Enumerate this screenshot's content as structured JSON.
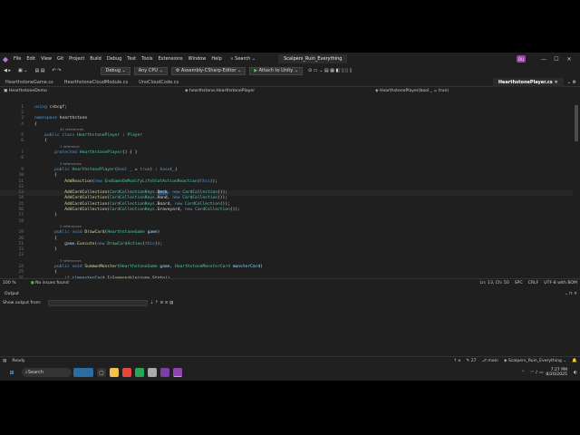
{
  "menubar": {
    "items": [
      "File",
      "Edit",
      "View",
      "Git",
      "Project",
      "Build",
      "Debug",
      "Test",
      "Tools",
      "Extensions",
      "Window",
      "Help"
    ],
    "search_label": "Search",
    "solution_name": "Scalpers_Ruin_Everything",
    "avatar_text": "DU"
  },
  "toolbar": {
    "config": "Debug",
    "platform": "Any CPU",
    "startup_project": "Assembly-CSharp-Editor",
    "attach_label": "Attach to Unity"
  },
  "tabs": [
    "HearthstoneGame.cs",
    "HearthstoneCloudModule.cs",
    "UnoCloudCode.cs",
    "HearthstonePlayer.cs"
  ],
  "navbar": {
    "project": "HearthstoneDemo",
    "type": "hearthstone.HearthstonePlayer",
    "member": "HearthstonePlayer(bool _ = true)"
  },
  "code": {
    "lines": [
      {
        "n": "1",
        "text": "using csbcgf;"
      },
      {
        "n": "2",
        "text": ""
      },
      {
        "n": "3",
        "text": "namespace hearthstone"
      },
      {
        "n": "4",
        "text": "{"
      },
      {
        "lens": "40 references"
      },
      {
        "n": "5",
        "text": "    public class HearthstonePlayer : Player"
      },
      {
        "n": "6",
        "text": "    {"
      },
      {
        "lens": "1 reference"
      },
      {
        "n": "7",
        "text": "        protected HearthstonePlayer() { }"
      },
      {
        "n": "8",
        "text": ""
      },
      {
        "lens": "3 references"
      },
      {
        "n": "9",
        "text": "        public HearthstonePlayer(bool _ = true) : base(_)"
      },
      {
        "n": "10",
        "text": "        {"
      },
      {
        "n": "11",
        "text": "            AddReaction(new EndGameOnModifyLifeStatActionReaction(this));"
      },
      {
        "n": "12",
        "text": ""
      },
      {
        "n": "13",
        "text": "            AddCardCollection(CardCollectionKeys.Deck, new CardCollection());"
      },
      {
        "n": "14",
        "text": "            AddCardCollection(CardCollectionKeys.Hand, new CardCollection());"
      },
      {
        "n": "15",
        "text": "            AddCardCollection(CardCollectionKeys.Board, new CardCollection());"
      },
      {
        "n": "16",
        "text": "            AddCardCollection(CardCollectionKeys.Graveyard, new CardCollection());"
      },
      {
        "n": "17",
        "text": "        }"
      },
      {
        "n": "18",
        "text": ""
      },
      {
        "lens": "2 references"
      },
      {
        "n": "19",
        "text": "        public void DrawCard(HearthstoneGame game)"
      },
      {
        "n": "20",
        "text": "        {"
      },
      {
        "n": "21",
        "text": "            game.Execute(new DrawCardAction(this));"
      },
      {
        "n": "22",
        "text": "        }"
      },
      {
        "n": "23",
        "text": ""
      },
      {
        "lens": "3 references"
      },
      {
        "n": "24",
        "text": "        public void SummonMonster(HearthstoneGame game, HearthstoneMonsterCard monsterCard)"
      },
      {
        "n": "25",
        "text": "        {"
      },
      {
        "n": "26",
        "text": "            if (!monsterCard.IsSummonable(game.State))"
      },
      {
        "n": "27",
        "text": "            {"
      },
      {
        "n": "28",
        "text": "                throw new CsbcgfException(\"Tried to play a card that is n"
      }
    ]
  },
  "status": {
    "zoom": "100 %",
    "issues": "No issues found",
    "position": "Ln: 13, Ch: 50",
    "spc": "SPC",
    "eol": "CRLF",
    "encoding": "UTF-8 with BOM"
  },
  "output": {
    "title": "Output",
    "show_from": "Show output from:"
  },
  "ready": {
    "text": "Ready",
    "errors": "27",
    "branch": "main",
    "repo": "Scalpers_Ruin_Everything"
  },
  "taskbar": {
    "search": "Search",
    "time": "7:27 PM",
    "date": "8/20/2025"
  }
}
